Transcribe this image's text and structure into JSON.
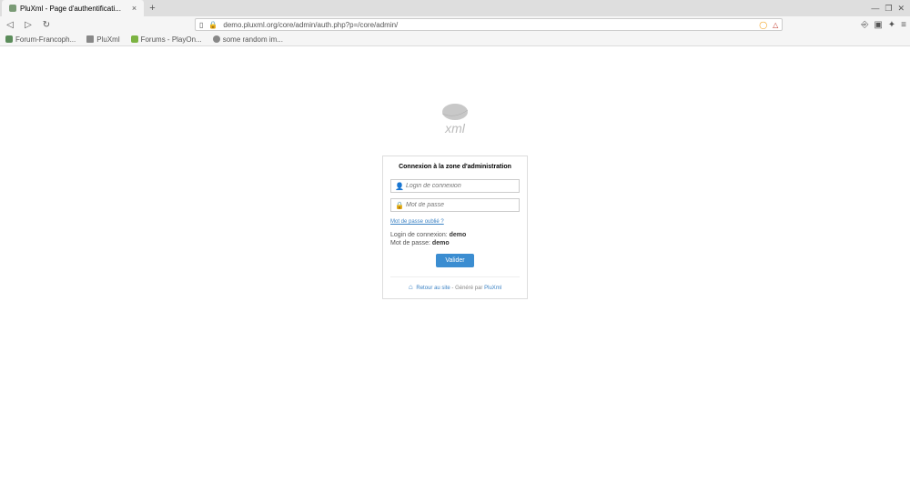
{
  "browser": {
    "tab_title": "PluXml - Page d'authentificati...",
    "url": "demo.pluxml.org/core/admin/auth.php?p=/core/admin/",
    "bookmarks": [
      {
        "label": "Forum-Francoph..."
      },
      {
        "label": "PluXml"
      },
      {
        "label": "Forums - PlayOn..."
      },
      {
        "label": "some random im..."
      }
    ]
  },
  "login": {
    "title": "Connexion à la zone d'administration",
    "login_placeholder": "Login de connexion",
    "password_placeholder": "Mot de passe",
    "forgot": "Mot de passe oublié ?",
    "hint_login_label": "Login de connexion: ",
    "hint_login_value": "demo",
    "hint_pass_label": "Mot de passe: ",
    "hint_pass_value": "demo",
    "submit": "Valider"
  },
  "footer": {
    "back": "Retour au site",
    "sep": " - Généré par ",
    "brand": "PluXml"
  }
}
